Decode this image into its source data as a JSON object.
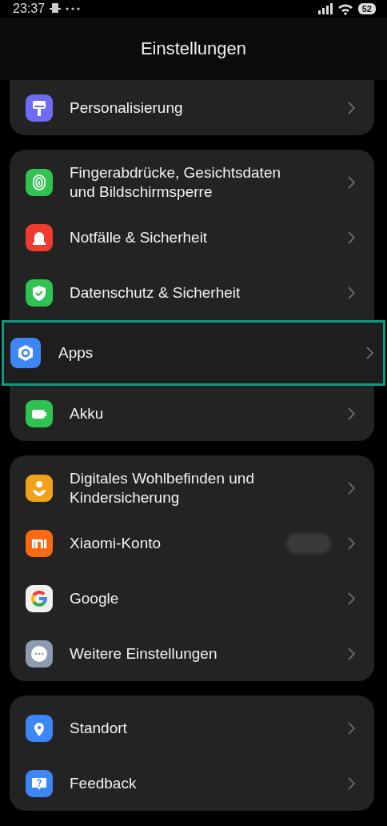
{
  "status_bar": {
    "time": "23:37",
    "battery": "52"
  },
  "header": {
    "title": "Einstellungen"
  },
  "sections": [
    {
      "scrolled_under": true,
      "items": [
        {
          "label": "Personalisierung",
          "kind": "brush",
          "color": "#6f6cf4",
          "highlighted": false
        }
      ]
    },
    {
      "scrolled_under": false,
      "items": [
        {
          "label": "Fingerabdrücke, Gesichtsdaten und Bildschirmsperre",
          "kind": "fingerprint",
          "color": "#2fc452",
          "highlighted": false
        },
        {
          "label": "Notfälle & Sicherheit",
          "kind": "siren",
          "color": "#ef3b30",
          "highlighted": false
        },
        {
          "label": "Datenschutz & Sicherheit",
          "kind": "shield",
          "color": "#2fc452",
          "highlighted": false
        },
        {
          "label": "Apps",
          "kind": "hexagon",
          "color": "#3c86f5",
          "highlighted": true
        },
        {
          "label": "Akku",
          "kind": "battery",
          "color": "#2fc452",
          "highlighted": false
        }
      ]
    },
    {
      "scrolled_under": false,
      "items": [
        {
          "label": "Digitales Wohlbefinden und Kindersicherung",
          "kind": "person",
          "color": "#f0a21c",
          "highlighted": false
        },
        {
          "label": "Xiaomi-Konto",
          "kind": "mi",
          "color": "#fb6a10",
          "highlighted": false,
          "redacted": true
        },
        {
          "label": "Google",
          "kind": "google",
          "color": "#f1f1f1",
          "highlighted": false
        },
        {
          "label": "Weitere Einstellungen",
          "kind": "dots",
          "color": "#8d9bb0",
          "highlighted": false
        }
      ]
    },
    {
      "scrolled_under": false,
      "items": [
        {
          "label": "Standort",
          "kind": "pin",
          "color": "#3c86f5",
          "highlighted": false
        },
        {
          "label": "Feedback",
          "kind": "help",
          "color": "#3c86f5",
          "highlighted": false
        }
      ]
    }
  ]
}
